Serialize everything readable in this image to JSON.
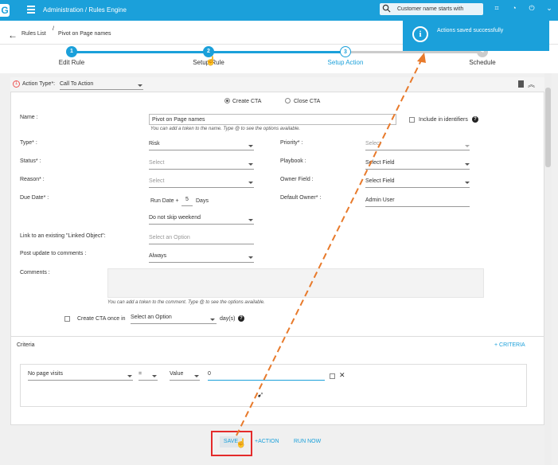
{
  "topbar": {
    "logo": "G",
    "title": "Administration / Rules Engine",
    "search_value": "Customer name starts with"
  },
  "breadcrumb": {
    "root": "Rules List",
    "separator": "/",
    "current": "Pivot on Page names"
  },
  "steps": [
    {
      "num": "1",
      "label": "Edit Rule",
      "state": "done"
    },
    {
      "num": "2",
      "label": "Setup Rule",
      "state": "done"
    },
    {
      "num": "3",
      "label": "Setup Action",
      "state": "active"
    },
    {
      "num": "4",
      "label": "Schedule",
      "state": "todo"
    }
  ],
  "toast": {
    "icon": "i",
    "text": "Actions saved successfully"
  },
  "action": {
    "index": "1",
    "type_label": "Action Type*:",
    "type_value": "Call To Action",
    "create_cta": "Create CTA",
    "close_cta": "Close CTA"
  },
  "form": {
    "name_label": "Name :",
    "name_value": "Pivot on Page names",
    "name_hint": "You can add a token to the name. Type @ to see the options available.",
    "include_identifiers": "Include in identifiers",
    "type_label": "Type* :",
    "type_value": "Risk",
    "status_label": "Status* :",
    "status_placeholder": "Select",
    "reason_label": "Reason* :",
    "reason_placeholder": "Select",
    "due_label": "Due Date* :",
    "due_base": "Run Date +",
    "due_num": "5",
    "due_unit": "Days",
    "weekend_value": "Do not skip weekend",
    "link_label": "Link to an existing \"Linked Object\":",
    "link_placeholder": "Select an Option",
    "post_label": "Post update to comments :",
    "post_value": "Always",
    "comments_label": "Comments :",
    "comments_hint": "You can add a token to the comment. Type @ to see the options available.",
    "once_label": "Create CTA once in",
    "once_placeholder": "Select an Option",
    "once_unit": "day(s)",
    "priority_label": "Priority* :",
    "priority_placeholder": "Select",
    "playbook_label": "Playbook :",
    "playbook_value": "Select Field",
    "owner_field_label": "Owner Field :",
    "owner_field_value": "Select Field",
    "default_owner_label": "Default Owner* :",
    "default_owner_value": "Admin User"
  },
  "criteria": {
    "label": "Criteria",
    "add": "+ CRITERIA",
    "field": "No page visits",
    "operator": "=",
    "value_type": "Value",
    "value": "0"
  },
  "footer": {
    "save": "SAVE",
    "action": "+ACTION",
    "run_now": "RUN NOW"
  }
}
